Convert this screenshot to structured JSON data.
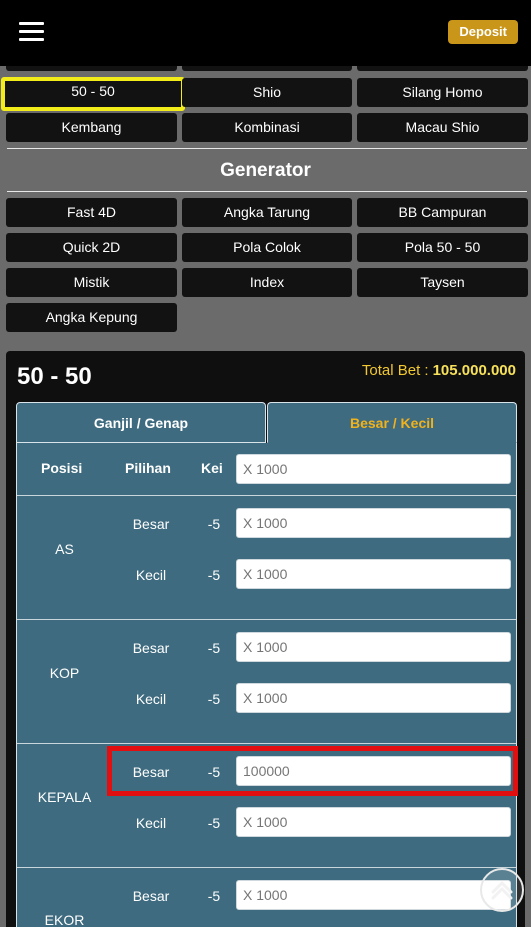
{
  "header": {
    "deposit_label": "Deposit"
  },
  "market_buttons": {
    "row1": [
      "50 - 50",
      "Shio",
      "Silang Homo"
    ],
    "row2": [
      "Kembang",
      "Kombinasi",
      "Macau Shio"
    ]
  },
  "generator": {
    "title": "Generator",
    "buttons": [
      "Fast 4D",
      "Angka Tarung",
      "BB Campuran",
      "Quick 2D",
      "Pola Colok",
      "Pola 50 - 50",
      "Mistik",
      "Index",
      "Taysen",
      "Angka Kepung"
    ]
  },
  "panel": {
    "title": "50 - 50",
    "total_label": "Total Bet :",
    "total_value": "105.000.000",
    "tabs": [
      "Ganjil / Genap",
      "Besar / Kecil"
    ],
    "active_tab": "Besar / Kecil",
    "headers": {
      "posisi": "Posisi",
      "pilihan": "Pilihan",
      "kei": "Kei",
      "input_placeholder": "X 1000"
    },
    "rows": [
      {
        "posisi": "AS",
        "options": [
          {
            "pilihan": "Besar",
            "kei": "-5",
            "value": "",
            "placeholder": "X 1000"
          },
          {
            "pilihan": "Kecil",
            "kei": "-5",
            "value": "",
            "placeholder": "X 1000"
          }
        ]
      },
      {
        "posisi": "KOP",
        "options": [
          {
            "pilihan": "Besar",
            "kei": "-5",
            "value": "",
            "placeholder": "X 1000"
          },
          {
            "pilihan": "Kecil",
            "kei": "-5",
            "value": "",
            "placeholder": "X 1000"
          }
        ]
      },
      {
        "posisi": "KEPALA",
        "options": [
          {
            "pilihan": "Besar",
            "kei": "-5",
            "value": "100000",
            "placeholder": "X 1000"
          },
          {
            "pilihan": "Kecil",
            "kei": "-5",
            "value": "",
            "placeholder": "X 1000"
          }
        ]
      },
      {
        "posisi": "EKOR",
        "options": [
          {
            "pilihan": "Besar",
            "kei": "-5",
            "value": "",
            "placeholder": "X 1000"
          }
        ]
      }
    ]
  },
  "colors": {
    "accent": "#c9961a",
    "table_bg": "#3e6b7f",
    "highlight_yellow": "#f2ec1a",
    "highlight_red": "#e10f0f",
    "total_value": "#f7e15a"
  }
}
